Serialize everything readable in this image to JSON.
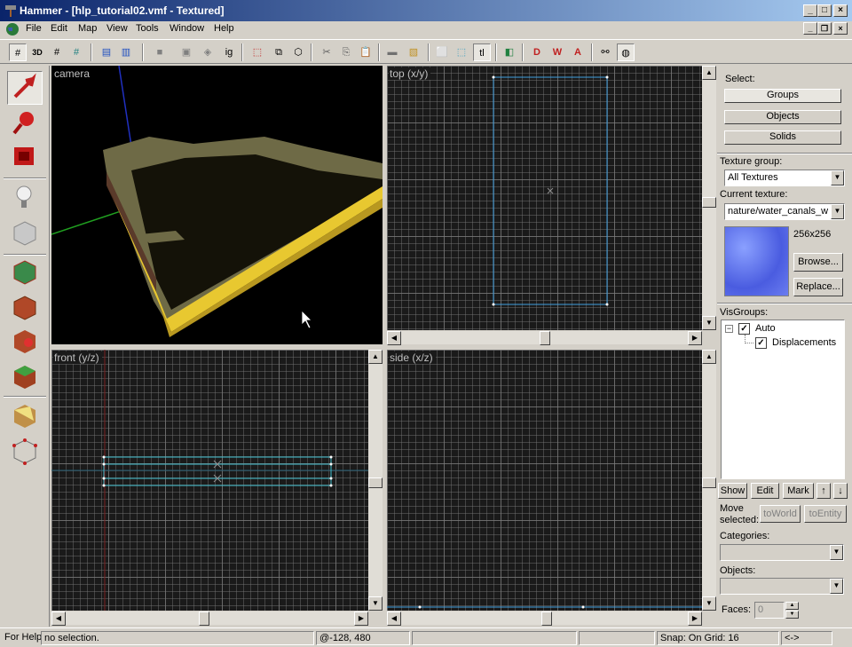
{
  "window": {
    "title": "Hammer - [hlp_tutorial02.vmf - Textured]"
  },
  "menu": [
    "File",
    "Edit",
    "Map",
    "View",
    "Tools",
    "Window",
    "Help"
  ],
  "toolbar": {
    "texture_lock_label": "tl",
    "ignore_groups_label": "ig",
    "three_d_label": "3D"
  },
  "viewports": {
    "camera": "camera",
    "top": "top (x/y)",
    "front": "front (y/z)",
    "side": "side (x/z)"
  },
  "select": {
    "label": "Select:",
    "groups": "Groups",
    "objects": "Objects",
    "solids": "Solids"
  },
  "texture": {
    "group_label": "Texture group:",
    "group_value": "All Textures",
    "current_label": "Current texture:",
    "current_value": "nature/water_canals_w",
    "size": "256x256",
    "browse": "Browse...",
    "replace": "Replace...",
    "swatch_color": "#5a6ee0"
  },
  "visgroups": {
    "label": "VisGroups:",
    "items": [
      {
        "name": "Auto",
        "checked": "✓"
      },
      {
        "name": "Displacements",
        "checked": "✓"
      }
    ],
    "show": "Show",
    "edit": "Edit",
    "mark": "Mark",
    "up": "↑",
    "down": "↓"
  },
  "move_selected": {
    "label_line1": "Move",
    "label_line2": "selected:",
    "to_world": "toWorld",
    "to_entity": "toEntity"
  },
  "categories": {
    "label": "Categories:",
    "value": ""
  },
  "objects": {
    "label": "Objects:",
    "value": ""
  },
  "faces": {
    "label": "Faces:",
    "value": "0"
  },
  "status": {
    "help": "For Help",
    "selection": "no selection.",
    "coords": "@-128, 480",
    "snap": "Snap: On Grid: 16",
    "extra": "<->"
  }
}
